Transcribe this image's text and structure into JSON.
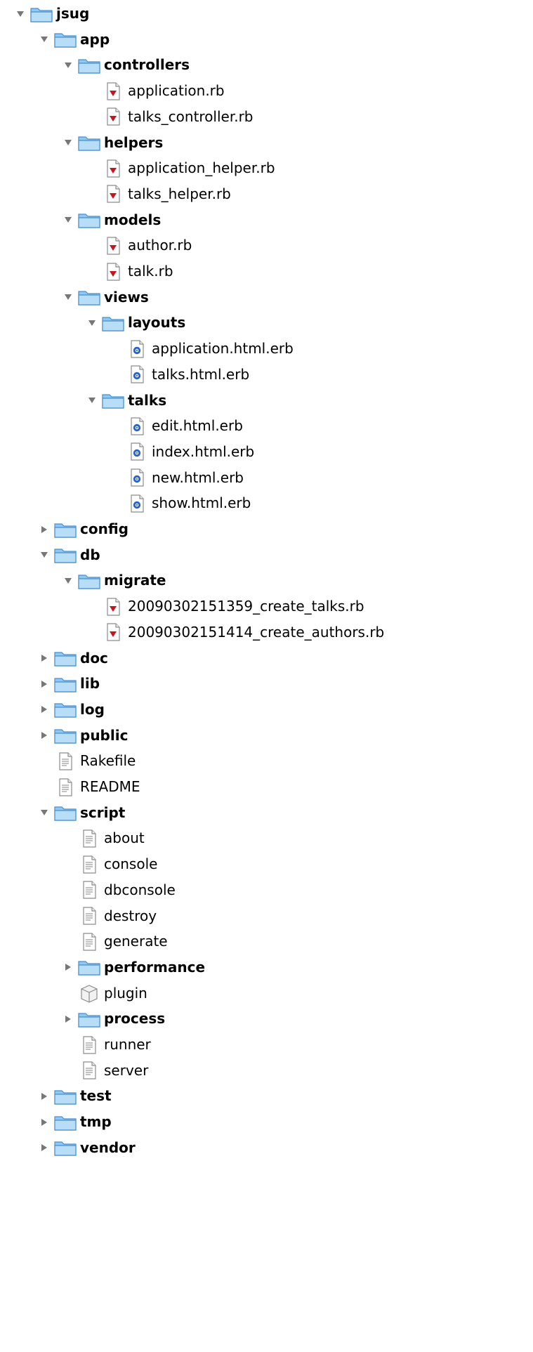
{
  "tree": {
    "rows": [
      {
        "label": "jsug",
        "kind": "folder",
        "depth": 0,
        "state": "open"
      },
      {
        "label": "app",
        "kind": "folder",
        "depth": 1,
        "state": "open"
      },
      {
        "label": "controllers",
        "kind": "folder",
        "depth": 2,
        "state": "open"
      },
      {
        "label": "application.rb",
        "kind": "ruby",
        "depth": 3
      },
      {
        "label": "talks_controller.rb",
        "kind": "ruby",
        "depth": 3
      },
      {
        "label": "helpers",
        "kind": "folder",
        "depth": 2,
        "state": "open"
      },
      {
        "label": "application_helper.rb",
        "kind": "ruby",
        "depth": 3
      },
      {
        "label": "talks_helper.rb",
        "kind": "ruby",
        "depth": 3
      },
      {
        "label": "models",
        "kind": "folder",
        "depth": 2,
        "state": "open"
      },
      {
        "label": "author.rb",
        "kind": "ruby",
        "depth": 3
      },
      {
        "label": "talk.rb",
        "kind": "ruby",
        "depth": 3
      },
      {
        "label": "views",
        "kind": "folder",
        "depth": 2,
        "state": "open"
      },
      {
        "label": "layouts",
        "kind": "folder",
        "depth": 3,
        "state": "open"
      },
      {
        "label": "application.html.erb",
        "kind": "html",
        "depth": 4
      },
      {
        "label": "talks.html.erb",
        "kind": "html",
        "depth": 4
      },
      {
        "label": "talks",
        "kind": "folder",
        "depth": 3,
        "state": "open"
      },
      {
        "label": "edit.html.erb",
        "kind": "html",
        "depth": 4
      },
      {
        "label": "index.html.erb",
        "kind": "html",
        "depth": 4
      },
      {
        "label": "new.html.erb",
        "kind": "html",
        "depth": 4
      },
      {
        "label": "show.html.erb",
        "kind": "html",
        "depth": 4
      },
      {
        "label": "config",
        "kind": "folder",
        "depth": 1,
        "state": "closed"
      },
      {
        "label": "db",
        "kind": "folder",
        "depth": 1,
        "state": "open"
      },
      {
        "label": "migrate",
        "kind": "folder",
        "depth": 2,
        "state": "open"
      },
      {
        "label": "20090302151359_create_talks.rb",
        "kind": "ruby",
        "depth": 3
      },
      {
        "label": "20090302151414_create_authors.rb",
        "kind": "ruby",
        "depth": 3
      },
      {
        "label": "doc",
        "kind": "folder",
        "depth": 1,
        "state": "closed"
      },
      {
        "label": "lib",
        "kind": "folder",
        "depth": 1,
        "state": "closed"
      },
      {
        "label": "log",
        "kind": "folder",
        "depth": 1,
        "state": "closed"
      },
      {
        "label": "public",
        "kind": "folder",
        "depth": 1,
        "state": "closed"
      },
      {
        "label": "Rakefile",
        "kind": "text",
        "depth": 1
      },
      {
        "label": "README",
        "kind": "text",
        "depth": 1
      },
      {
        "label": "script",
        "kind": "folder",
        "depth": 1,
        "state": "open"
      },
      {
        "label": "about",
        "kind": "text",
        "depth": 2
      },
      {
        "label": "console",
        "kind": "text",
        "depth": 2
      },
      {
        "label": "dbconsole",
        "kind": "text",
        "depth": 2
      },
      {
        "label": "destroy",
        "kind": "text",
        "depth": 2
      },
      {
        "label": "generate",
        "kind": "text",
        "depth": 2
      },
      {
        "label": "performance",
        "kind": "folder",
        "depth": 2,
        "state": "closed"
      },
      {
        "label": "plugin",
        "kind": "plugin",
        "depth": 2
      },
      {
        "label": "process",
        "kind": "folder",
        "depth": 2,
        "state": "closed"
      },
      {
        "label": "runner",
        "kind": "text",
        "depth": 2
      },
      {
        "label": "server",
        "kind": "text",
        "depth": 2
      },
      {
        "label": "test",
        "kind": "folder",
        "depth": 1,
        "state": "closed"
      },
      {
        "label": "tmp",
        "kind": "folder",
        "depth": 1,
        "state": "closed"
      },
      {
        "label": "vendor",
        "kind": "folder",
        "depth": 1,
        "state": "closed"
      }
    ]
  },
  "colors": {
    "folder_fill": "#8fc8f0",
    "folder_edge": "#4a8fcd",
    "ruby_red": "#c4161c",
    "html_blue": "#2a63c9",
    "page_gray": "#8c8c8c"
  }
}
